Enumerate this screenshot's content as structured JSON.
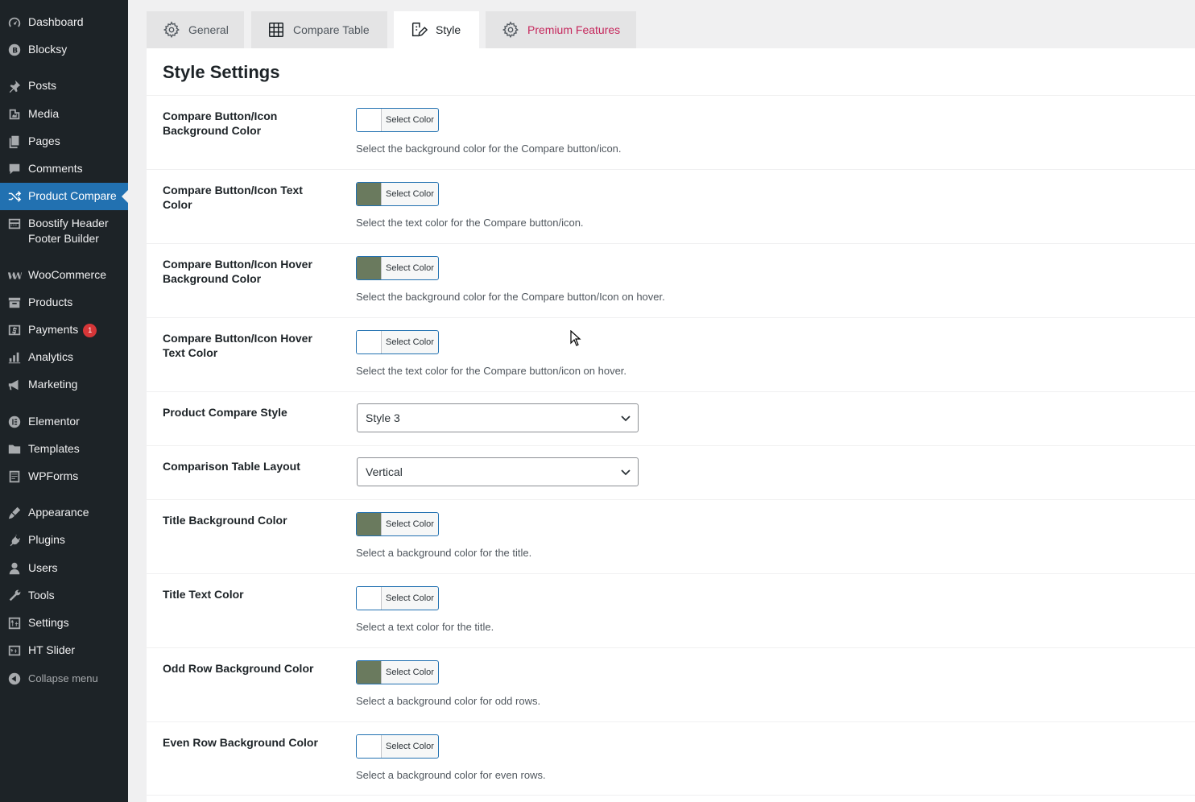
{
  "sidebar": {
    "items": [
      {
        "label": "Dashboard",
        "icon": "dashboard-icon"
      },
      {
        "label": "Blocksy",
        "icon": "blocksy-icon"
      },
      {
        "label": "Posts",
        "icon": "pin-icon"
      },
      {
        "label": "Media",
        "icon": "media-icon"
      },
      {
        "label": "Pages",
        "icon": "pages-icon"
      },
      {
        "label": "Comments",
        "icon": "comments-icon"
      },
      {
        "label": "Product Compare",
        "icon": "shuffle-icon"
      },
      {
        "label": "Boostify Header Footer Builder",
        "icon": "builder-icon"
      },
      {
        "label": "WooCommerce",
        "icon": "woocommerce-icon"
      },
      {
        "label": "Products",
        "icon": "archive-icon"
      },
      {
        "label": "Payments",
        "icon": "payments-icon",
        "badge": "1"
      },
      {
        "label": "Analytics",
        "icon": "analytics-icon"
      },
      {
        "label": "Marketing",
        "icon": "megaphone-icon"
      },
      {
        "label": "Elementor",
        "icon": "elementor-icon"
      },
      {
        "label": "Templates",
        "icon": "folder-icon"
      },
      {
        "label": "WPForms",
        "icon": "forms-icon"
      },
      {
        "label": "Appearance",
        "icon": "brush-icon"
      },
      {
        "label": "Plugins",
        "icon": "plug-icon"
      },
      {
        "label": "Users",
        "icon": "user-icon"
      },
      {
        "label": "Tools",
        "icon": "wrench-icon"
      },
      {
        "label": "Settings",
        "icon": "settings-icon"
      },
      {
        "label": "HT Slider",
        "icon": "slider-icon"
      },
      {
        "label": "Collapse menu",
        "icon": "collapse-icon"
      }
    ]
  },
  "tabs": [
    {
      "label": "General",
      "icon": "gear-icon"
    },
    {
      "label": "Compare Table",
      "icon": "table-grid-icon"
    },
    {
      "label": "Style",
      "icon": "style-brush-icon"
    },
    {
      "label": "Premium Features",
      "icon": "gear-icon"
    }
  ],
  "panel": {
    "title": "Style Settings",
    "select_color_label": "Select Color",
    "fields": [
      {
        "label": "Compare Button/Icon Background Color",
        "description": "Select the background color for the Compare button/icon.",
        "color": "#ffffff"
      },
      {
        "label": "Compare Button/Icon Text Color",
        "description": "Select the text color for the Compare button/icon.",
        "color": "#6a7a5e"
      },
      {
        "label": "Compare Button/Icon Hover Background Color",
        "description": "Select the background color for the Compare button/Icon on hover.",
        "color": "#6a7a5e"
      },
      {
        "label": "Compare Button/Icon Hover Text Color",
        "description": "Select the text color for the Compare button/icon on hover.",
        "color": "#ffffff"
      },
      {
        "label": "Product Compare Style",
        "select_value": "Style 3"
      },
      {
        "label": "Comparison Table Layout",
        "select_value": "Vertical"
      },
      {
        "label": "Title Background Color",
        "description": "Select a background color for the title.",
        "color": "#6a7a5e"
      },
      {
        "label": "Title Text Color",
        "description": "Select a text color for the title.",
        "color": "#ffffff"
      },
      {
        "label": "Odd Row Background Color",
        "description": "Select a background color for odd rows.",
        "color": "#6a7a5e"
      },
      {
        "label": "Even Row Background Color",
        "description": "Select a background color for even rows.",
        "color": "#ffffff"
      }
    ]
  },
  "colors": {
    "sidebar_bg": "#1d2327",
    "active_menu": "#2271b1",
    "premium_tab": "#c5275c",
    "swatch_green": "#6a7a5e"
  }
}
